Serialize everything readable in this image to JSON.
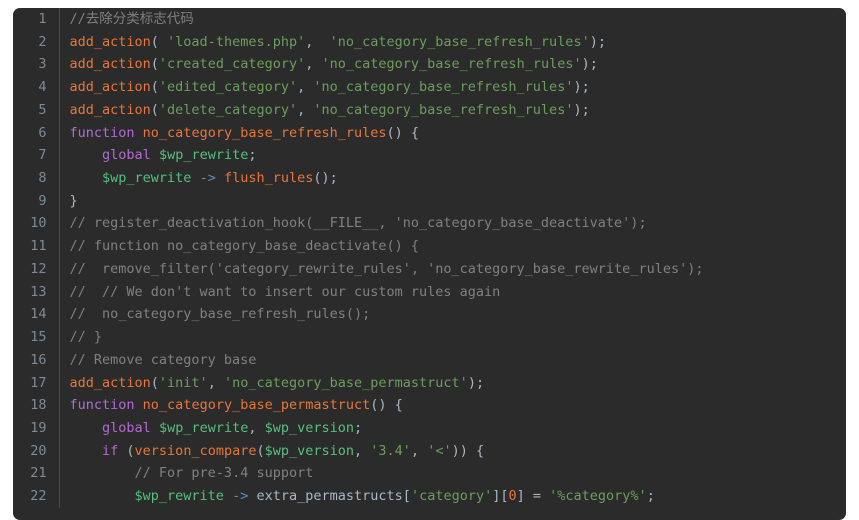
{
  "editor": {
    "background_color": "#2b2b2b",
    "page_background_color": "#ffffff",
    "gutter_divider_color": "#4a4a4a",
    "line_number_color": "#7d8a97",
    "language": "php",
    "first_visible_line": 1,
    "last_visible_line": 22,
    "colors": {
      "comment": "#808080",
      "function": "#e8763a",
      "string": "#6a9f5b",
      "variable": "#55c07d",
      "keyword": "#b36ad4",
      "operator": "#5a8fbd",
      "number": "#e8763a",
      "plain": "#a9b7c6"
    }
  },
  "lines": [
    {
      "number": "1",
      "tokens": [
        {
          "t": "//去除分类标志代码",
          "c": "tok-comment"
        }
      ]
    },
    {
      "number": "2",
      "tokens": [
        {
          "t": "add_action",
          "c": "tok-func"
        },
        {
          "t": "( ",
          "c": "tok-punct"
        },
        {
          "t": "'load-themes.php'",
          "c": "tok-string"
        },
        {
          "t": ",  ",
          "c": "tok-punct"
        },
        {
          "t": "'no_category_base_refresh_rules'",
          "c": "tok-string"
        },
        {
          "t": ");",
          "c": "tok-punct"
        }
      ]
    },
    {
      "number": "3",
      "tokens": [
        {
          "t": "add_action",
          "c": "tok-func"
        },
        {
          "t": "(",
          "c": "tok-punct"
        },
        {
          "t": "'created_category'",
          "c": "tok-string"
        },
        {
          "t": ", ",
          "c": "tok-punct"
        },
        {
          "t": "'no_category_base_refresh_rules'",
          "c": "tok-string"
        },
        {
          "t": ");",
          "c": "tok-punct"
        }
      ]
    },
    {
      "number": "4",
      "tokens": [
        {
          "t": "add_action",
          "c": "tok-func"
        },
        {
          "t": "(",
          "c": "tok-punct"
        },
        {
          "t": "'edited_category'",
          "c": "tok-string"
        },
        {
          "t": ", ",
          "c": "tok-punct"
        },
        {
          "t": "'no_category_base_refresh_rules'",
          "c": "tok-string"
        },
        {
          "t": ");",
          "c": "tok-punct"
        }
      ]
    },
    {
      "number": "5",
      "tokens": [
        {
          "t": "add_action",
          "c": "tok-func"
        },
        {
          "t": "(",
          "c": "tok-punct"
        },
        {
          "t": "'delete_category'",
          "c": "tok-string"
        },
        {
          "t": ", ",
          "c": "tok-punct"
        },
        {
          "t": "'no_category_base_refresh_rules'",
          "c": "tok-string"
        },
        {
          "t": ");",
          "c": "tok-punct"
        }
      ]
    },
    {
      "number": "6",
      "tokens": [
        {
          "t": "function",
          "c": "tok-keyword"
        },
        {
          "t": " ",
          "c": "tok-plain"
        },
        {
          "t": "no_category_base_refresh_rules",
          "c": "tok-func"
        },
        {
          "t": "() {",
          "c": "tok-punct"
        }
      ]
    },
    {
      "number": "7",
      "tokens": [
        {
          "t": "    ",
          "c": "tok-plain"
        },
        {
          "t": "global",
          "c": "tok-keyword"
        },
        {
          "t": " ",
          "c": "tok-plain"
        },
        {
          "t": "$wp_rewrite",
          "c": "tok-var"
        },
        {
          "t": ";",
          "c": "tok-punct"
        }
      ]
    },
    {
      "number": "8",
      "tokens": [
        {
          "t": "    ",
          "c": "tok-plain"
        },
        {
          "t": "$wp_rewrite",
          "c": "tok-var"
        },
        {
          "t": " ",
          "c": "tok-plain"
        },
        {
          "t": "->",
          "c": "tok-arrow"
        },
        {
          "t": " ",
          "c": "tok-plain"
        },
        {
          "t": "flush_rules",
          "c": "tok-func"
        },
        {
          "t": "();",
          "c": "tok-punct"
        }
      ]
    },
    {
      "number": "9",
      "tokens": [
        {
          "t": "}",
          "c": "tok-punct"
        }
      ]
    },
    {
      "number": "10",
      "tokens": [
        {
          "t": "// register_deactivation_hook(__FILE__, 'no_category_base_deactivate');",
          "c": "tok-comment"
        }
      ]
    },
    {
      "number": "11",
      "tokens": [
        {
          "t": "// function no_category_base_deactivate() {",
          "c": "tok-comment"
        }
      ]
    },
    {
      "number": "12",
      "tokens": [
        {
          "t": "//  remove_filter('category_rewrite_rules', 'no_category_base_rewrite_rules');",
          "c": "tok-comment"
        }
      ]
    },
    {
      "number": "13",
      "tokens": [
        {
          "t": "//  // We don't want to insert our custom rules again",
          "c": "tok-comment"
        }
      ]
    },
    {
      "number": "14",
      "tokens": [
        {
          "t": "//  no_category_base_refresh_rules();",
          "c": "tok-comment"
        }
      ]
    },
    {
      "number": "15",
      "tokens": [
        {
          "t": "// }",
          "c": "tok-comment"
        }
      ]
    },
    {
      "number": "16",
      "tokens": [
        {
          "t": "// Remove category base",
          "c": "tok-comment"
        }
      ]
    },
    {
      "number": "17",
      "tokens": [
        {
          "t": "add_action",
          "c": "tok-func"
        },
        {
          "t": "(",
          "c": "tok-punct"
        },
        {
          "t": "'init'",
          "c": "tok-string"
        },
        {
          "t": ", ",
          "c": "tok-punct"
        },
        {
          "t": "'no_category_base_permastruct'",
          "c": "tok-string"
        },
        {
          "t": ");",
          "c": "tok-punct"
        }
      ]
    },
    {
      "number": "18",
      "tokens": [
        {
          "t": "function",
          "c": "tok-keyword"
        },
        {
          "t": " ",
          "c": "tok-plain"
        },
        {
          "t": "no_category_base_permastruct",
          "c": "tok-func"
        },
        {
          "t": "() {",
          "c": "tok-punct"
        }
      ]
    },
    {
      "number": "19",
      "tokens": [
        {
          "t": "    ",
          "c": "tok-plain"
        },
        {
          "t": "global",
          "c": "tok-keyword"
        },
        {
          "t": " ",
          "c": "tok-plain"
        },
        {
          "t": "$wp_rewrite",
          "c": "tok-var"
        },
        {
          "t": ", ",
          "c": "tok-punct"
        },
        {
          "t": "$wp_version",
          "c": "tok-var"
        },
        {
          "t": ";",
          "c": "tok-punct"
        }
      ]
    },
    {
      "number": "20",
      "tokens": [
        {
          "t": "    ",
          "c": "tok-plain"
        },
        {
          "t": "if",
          "c": "tok-keyword"
        },
        {
          "t": " (",
          "c": "tok-punct"
        },
        {
          "t": "version_compare",
          "c": "tok-func"
        },
        {
          "t": "(",
          "c": "tok-punct"
        },
        {
          "t": "$wp_version",
          "c": "tok-var"
        },
        {
          "t": ", ",
          "c": "tok-punct"
        },
        {
          "t": "'3.4'",
          "c": "tok-string"
        },
        {
          "t": ", ",
          "c": "tok-punct"
        },
        {
          "t": "'<'",
          "c": "tok-string"
        },
        {
          "t": ")) {",
          "c": "tok-punct"
        }
      ]
    },
    {
      "number": "21",
      "tokens": [
        {
          "t": "        ",
          "c": "tok-plain"
        },
        {
          "t": "// For pre-3.4 support",
          "c": "tok-comment"
        }
      ]
    },
    {
      "number": "22",
      "tokens": [
        {
          "t": "        ",
          "c": "tok-plain"
        },
        {
          "t": "$wp_rewrite",
          "c": "tok-var"
        },
        {
          "t": " ",
          "c": "tok-plain"
        },
        {
          "t": "->",
          "c": "tok-arrow"
        },
        {
          "t": " ",
          "c": "tok-plain"
        },
        {
          "t": "extra_permastructs",
          "c": "tok-plain"
        },
        {
          "t": "[",
          "c": "tok-punct"
        },
        {
          "t": "'category'",
          "c": "tok-string"
        },
        {
          "t": "][",
          "c": "tok-punct"
        },
        {
          "t": "0",
          "c": "tok-number"
        },
        {
          "t": "] = ",
          "c": "tok-punct"
        },
        {
          "t": "'%category%'",
          "c": "tok-string"
        },
        {
          "t": ";",
          "c": "tok-punct"
        }
      ]
    }
  ]
}
